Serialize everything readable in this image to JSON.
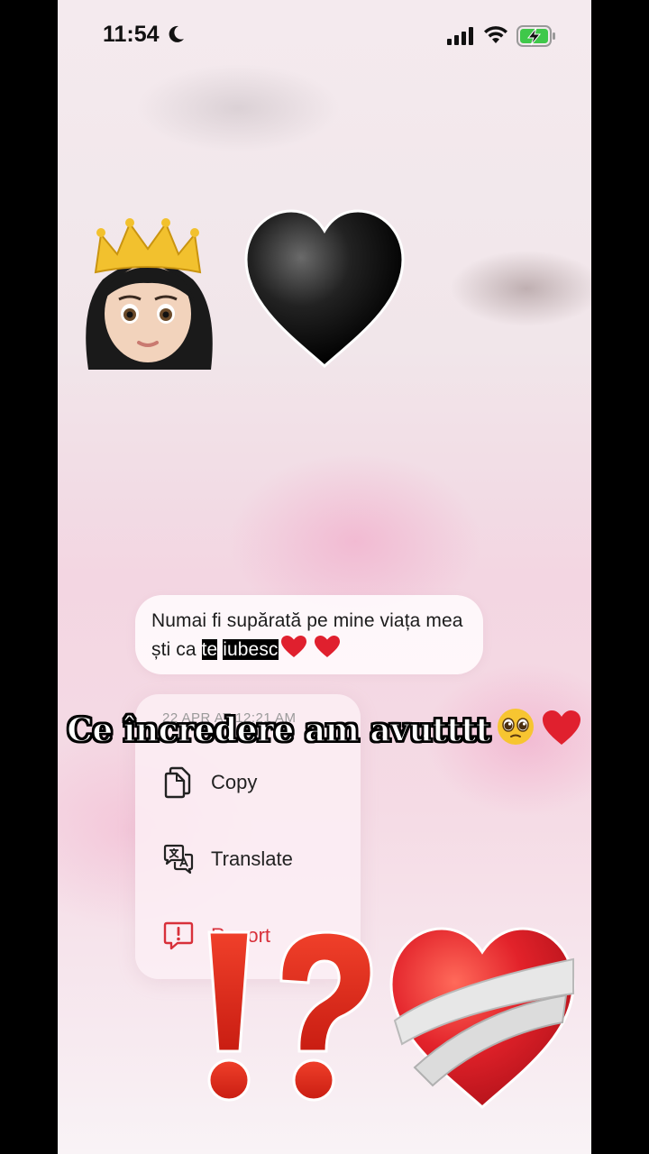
{
  "status_bar": {
    "time": "11:54",
    "icons": [
      "moon-icon",
      "cellular-signal-icon",
      "wifi-icon",
      "battery-charging-icon"
    ]
  },
  "message": {
    "text_before": "Numai fi supărată pe mine viața mea ști ca ",
    "highlight_1": "te",
    "highlight_2": "iubesc",
    "trailing_emoji": [
      "red-heart-icon",
      "red-heart-icon"
    ]
  },
  "context_menu": {
    "timestamp": "22 APR AT 12:21 AM",
    "items": [
      {
        "label": "Copy",
        "icon": "copy-icon"
      },
      {
        "label": "Translate",
        "icon": "translate-icon"
      },
      {
        "label": "Report",
        "icon": "report-icon"
      }
    ]
  },
  "caption": {
    "text": "Ce încredere am avutttt",
    "emoji": [
      "pleading-face-icon",
      "red-heart-icon"
    ]
  },
  "stickers": [
    "princess-emoji",
    "black-heart-emoji",
    "exclamation-question-emoji",
    "mending-heart-emoji"
  ],
  "colors": {
    "report_red": "#d8303a",
    "highlight_bg": "#000000",
    "battery_green": "#3fc84a"
  }
}
